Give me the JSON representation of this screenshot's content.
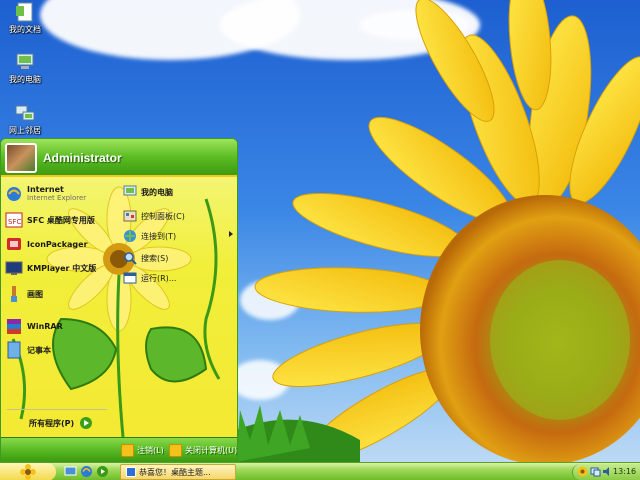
{
  "desktop": {
    "icons": [
      {
        "label": "我的文档",
        "icon": "my-documents-icon"
      },
      {
        "label": "我的电脑",
        "icon": "my-computer-icon"
      },
      {
        "label": "网上邻居",
        "icon": "network-places-icon"
      }
    ]
  },
  "start_menu": {
    "username": "Administrator",
    "left_items": [
      {
        "title": "Internet",
        "subtitle": "Internet Explorer",
        "icon": "internet-explorer-icon"
      },
      {
        "title": "SFC 桌酷网专用版",
        "subtitle": "",
        "icon": "sfc-app-icon"
      },
      {
        "title": "IconPackager",
        "subtitle": "",
        "icon": "iconpackager-icon"
      },
      {
        "title": "KMPlayer 中文版",
        "subtitle": "",
        "icon": "kmplayer-icon"
      },
      {
        "title": "画图",
        "subtitle": "",
        "icon": "paint-icon"
      },
      {
        "title": "WinRAR",
        "subtitle": "",
        "icon": "winrar-icon"
      },
      {
        "title": "记事本",
        "subtitle": "",
        "icon": "notepad-icon"
      }
    ],
    "right_items": [
      {
        "title": "我的电脑",
        "icon": "my-computer-icon",
        "bold": true
      },
      {
        "title": "控制面板(C)",
        "icon": "control-panel-icon",
        "bold": false
      },
      {
        "title": "连接到(T)",
        "icon": "connect-to-icon",
        "bold": false
      },
      {
        "title": "搜索(S)",
        "icon": "search-icon",
        "bold": false
      },
      {
        "title": "运行(R)...",
        "icon": "run-icon",
        "bold": false
      }
    ],
    "all_programs": "所有程序(P)",
    "footer": {
      "logoff": "注销(L)",
      "shutdown": "关闭计算机(U)"
    }
  },
  "taskbar": {
    "task_item": "恭喜您！桌酷主题...",
    "clock": "13:16"
  },
  "colors": {
    "accent_green": "#4fb21c",
    "menu_yellow": "#f1ef3a",
    "sky_blue": "#3a86e6"
  }
}
